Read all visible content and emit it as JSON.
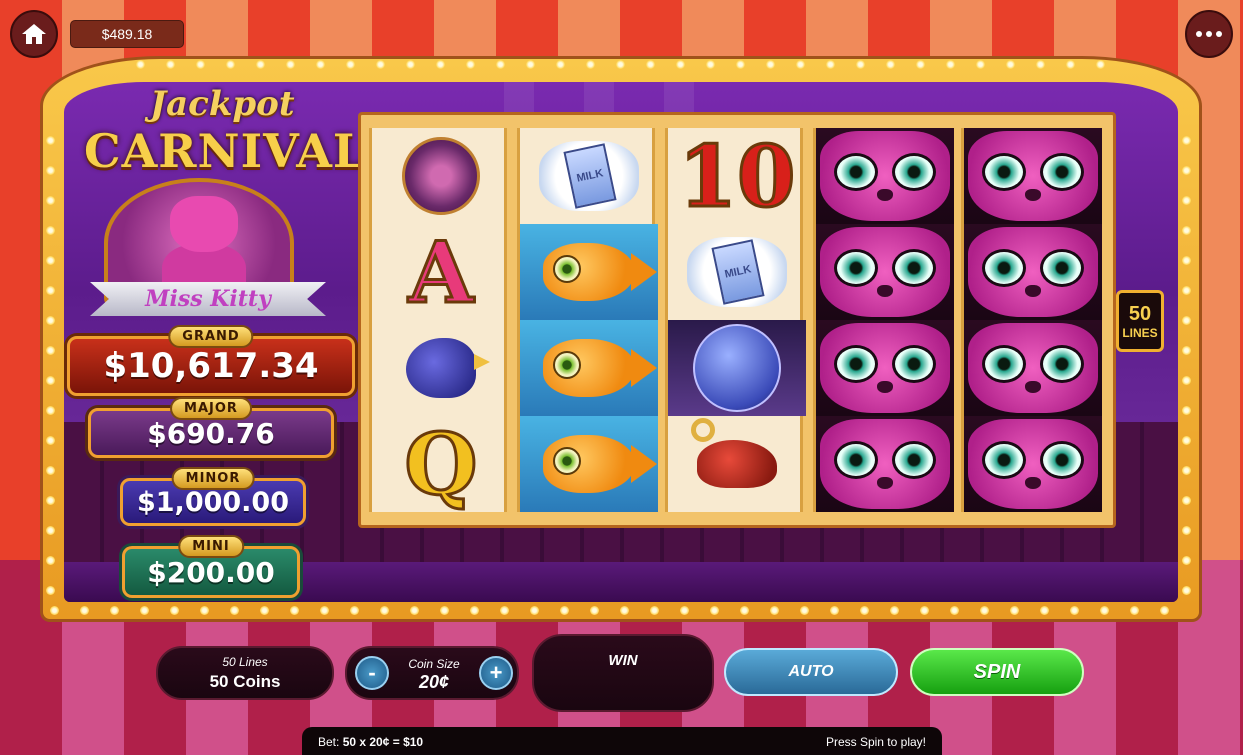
{
  "header": {
    "balance": "$489.18",
    "home_icon": "home-icon",
    "menu_icon": "more-dots-icon"
  },
  "logo": {
    "line1": "Jackpot",
    "line2": "CARNIVAL",
    "subtitle": "Miss Kitty"
  },
  "jackpots": {
    "grand": {
      "label": "GRAND",
      "value": "$10,617.34"
    },
    "major": {
      "label": "MAJOR",
      "value": "$690.76"
    },
    "minor": {
      "label": "MINOR",
      "value": "$1,000.00"
    },
    "mini": {
      "label": "MINI",
      "value": "$200.00"
    }
  },
  "reels": [
    [
      "yarn-ball",
      "A",
      "bluebird",
      "Q"
    ],
    [
      "milk",
      "goldfish",
      "goldfish",
      "goldfish"
    ],
    [
      "10",
      "milk",
      "moon",
      "wind-up-mouse"
    ],
    [
      "miss-kitty",
      "miss-kitty",
      "miss-kitty",
      "miss-kitty"
    ],
    [
      "miss-kitty",
      "miss-kitty",
      "miss-kitty",
      "miss-kitty"
    ]
  ],
  "symbol_text": {
    "ten": "10",
    "ace": "A",
    "queen": "Q",
    "milk": "MILK"
  },
  "lines_badge": {
    "number": "50",
    "label": "LINES"
  },
  "controls": {
    "lines_caption": "50 Lines",
    "lines_value": "50 Coins",
    "coin_size_label": "Coin Size",
    "coin_size_value": "20¢",
    "minus": "-",
    "plus": "+",
    "win_label": "WIN",
    "auto_label": "AUTO",
    "spin_label": "SPIN"
  },
  "status": {
    "bet_prefix": "Bet: ",
    "bet_formula": "50 x 20¢ = $10",
    "message": "Press Spin to play!"
  },
  "colors": {
    "spin": "#16a010",
    "auto": "#2a6a98",
    "grand": "#c8301a",
    "major": "#4a1a5a",
    "minor": "#2a1a7a",
    "mini": "#145a40"
  }
}
